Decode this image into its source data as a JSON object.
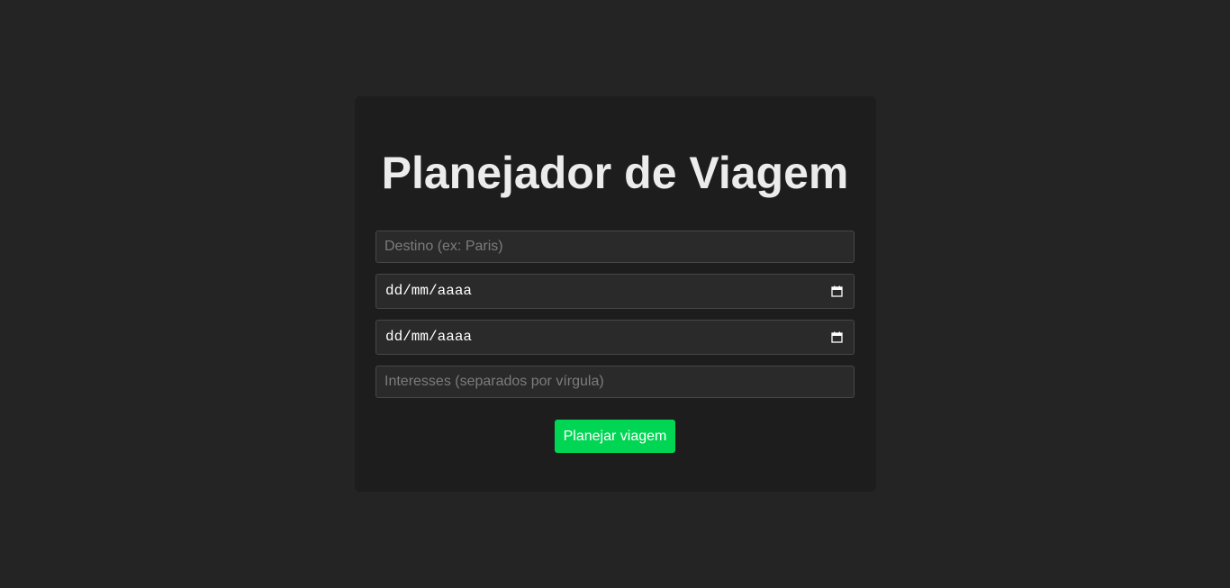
{
  "page": {
    "title": "Planejador de Viagem"
  },
  "form": {
    "destination": {
      "placeholder": "Destino (ex: Paris)",
      "value": ""
    },
    "start_date": {
      "display": "dd/mm/aaaa",
      "icon": "calendar-icon"
    },
    "end_date": {
      "display": "dd/mm/aaaa",
      "icon": "calendar-icon"
    },
    "interests": {
      "placeholder": "Interesses (separados por vírgula)",
      "value": ""
    },
    "submit_label": "Planejar viagem"
  },
  "colors": {
    "background": "#242424",
    "card": "#1d1d1d",
    "accent": "#00d654"
  }
}
